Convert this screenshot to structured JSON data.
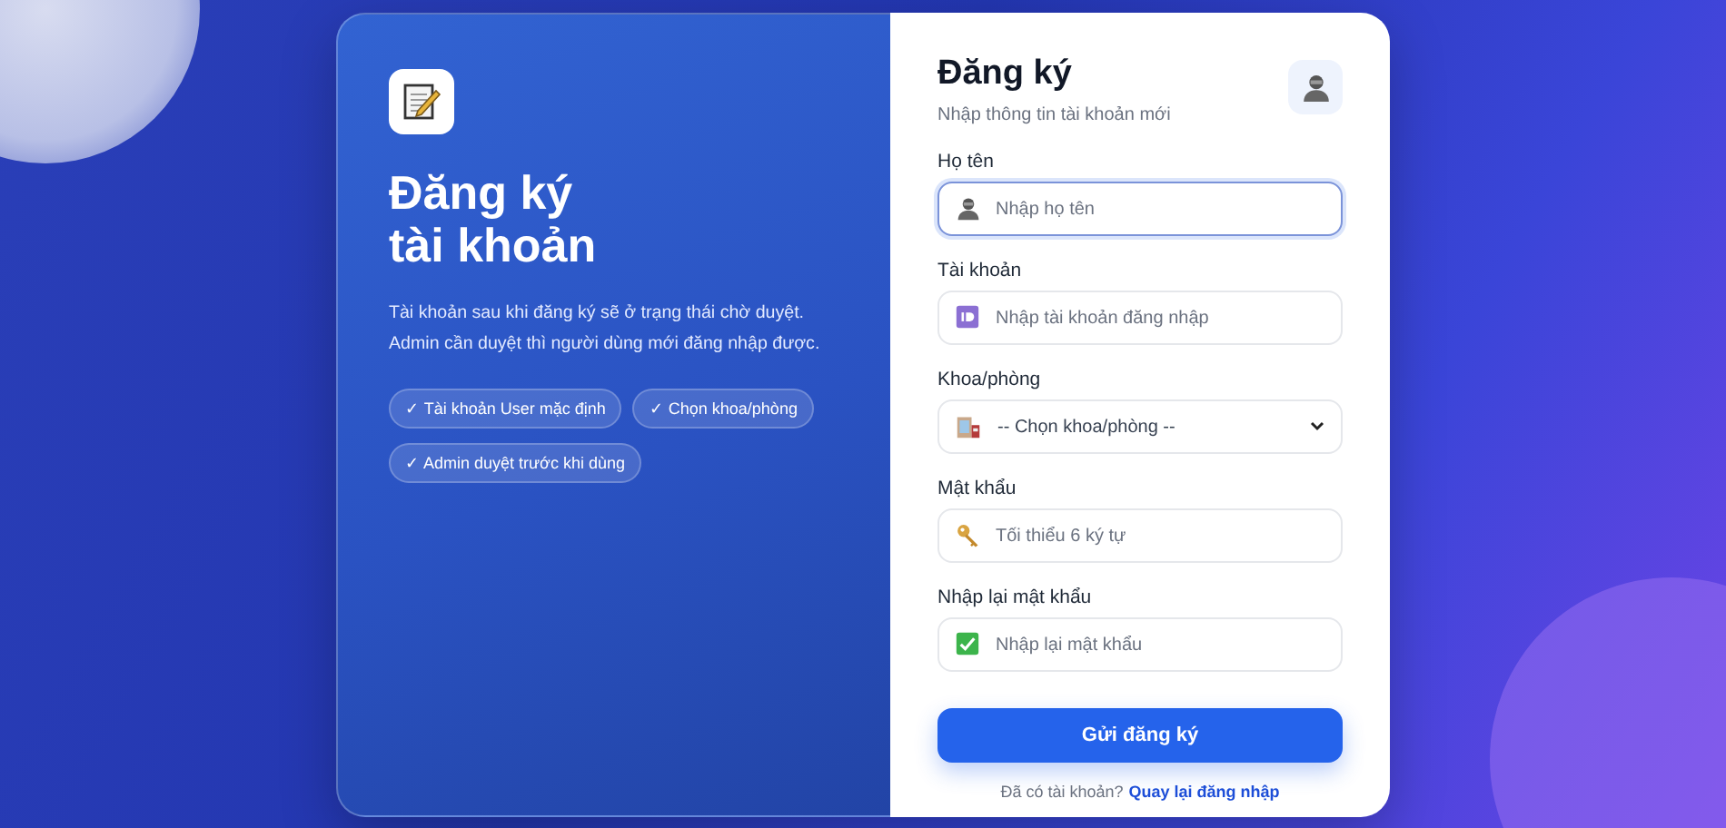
{
  "intro": {
    "title_lines": [
      "Đăng ký",
      "tài khoản"
    ],
    "description": "Tài khoản sau khi đăng ký sẽ ở trạng thái chờ duyệt. Admin cần duyệt thì người dùng mới đăng nhập được.",
    "chips": [
      "✓ Tài khoản User mặc định",
      "✓ Chọn khoa/phòng",
      "✓ Admin duyệt trước khi dùng"
    ]
  },
  "form": {
    "title": "Đăng ký",
    "subtitle": "Nhập thông tin tài khoản mới",
    "fields": [
      {
        "kind": "text",
        "label": "Họ tên",
        "placeholder": "Nhập họ tên",
        "focused": true
      },
      {
        "kind": "text",
        "label": "Tài khoản",
        "placeholder": "Nhập tài khoản đăng nhập",
        "focused": false
      },
      {
        "kind": "select",
        "label": "Khoa/phòng",
        "value": "-- Chọn khoa/phòng --",
        "focused": false
      },
      {
        "kind": "password",
        "label": "Mật khẩu",
        "placeholder": "Tối thiểu 6 ký tự",
        "focused": false
      },
      {
        "kind": "password",
        "label": "Nhập lại mật khẩu",
        "placeholder": "Nhập lại mật khẩu",
        "focused": false
      }
    ],
    "submit": "Gửi đăng ký",
    "footer": {
      "text": "Đã có tài khoản?",
      "link": "Quay lại đăng nhập"
    }
  }
}
